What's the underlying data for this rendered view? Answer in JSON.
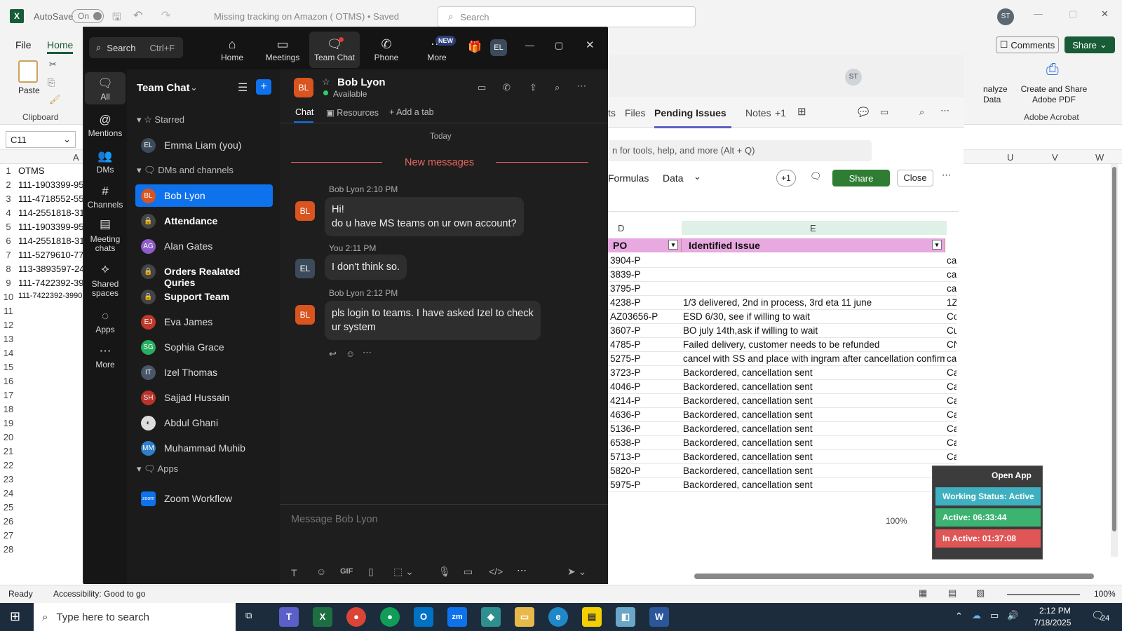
{
  "excel": {
    "autosave_label": "AutoSave",
    "autosave_state": "On",
    "doc_title": "Missing tracking on Amazon ( OTMS) • Saved",
    "search_placeholder": "Search",
    "user_initials": "ST",
    "menu": [
      "File",
      "Home"
    ],
    "comments_label": "Comments",
    "share_label": "Share",
    "paste_label": "Paste",
    "clipboard_label": "Clipboard",
    "analyze_label": "nalyze\nData",
    "create_share_pdf": "Create and Share Adobe PDF",
    "adobe_acrobat": "Adobe Acrobat",
    "name_box": "C11",
    "col_a": "A",
    "col_u": "U",
    "col_v": "V",
    "col_w": "W",
    "rows": [
      "1",
      "2",
      "3",
      "4",
      "5",
      "6",
      "7",
      "8",
      "9",
      "10",
      "11",
      "12",
      "13",
      "14",
      "15",
      "16",
      "17",
      "18",
      "19",
      "20",
      "21",
      "22",
      "23",
      "24",
      "25",
      "26",
      "27",
      "28"
    ],
    "col_a_values": [
      "OTMS",
      "111-1903399-95",
      "111-4718552-55",
      "114-2551818-31",
      "111-1903399-95",
      "114-2551818-31",
      "111-5279610-77",
      "113-3893597-24",
      "111-7422392-39",
      "111-7422392-3990"
    ],
    "status_ready": "Ready",
    "status_accessibility": "Accessibility: Good to go",
    "zoom_level": "100%"
  },
  "teams_panel": {
    "tabs": [
      "ts",
      "Files",
      "Pending Issues",
      "Notes",
      "+1"
    ],
    "search_hint": "n for tools, help, and more (Alt + Q)",
    "formulas": "Formulas",
    "data": "Data",
    "plus_one": "+1",
    "share": "Share",
    "close": "Close",
    "col_d": "D",
    "col_e": "E",
    "header_po": "PO",
    "header_issue": "Identified Issue",
    "zoom_level": "100%",
    "rows": [
      {
        "po": "3904-P",
        "issue": "",
        "f": "ca"
      },
      {
        "po": "3839-P",
        "issue": "",
        "f": "ca"
      },
      {
        "po": "3795-P",
        "issue": "",
        "f": "ca"
      },
      {
        "po": "4238-P",
        "issue": "1/3 delivered, 2nd in process, 3rd eta 11 june",
        "f": "1Z"
      },
      {
        "po": "AZ03656-P",
        "issue": "ESD 6/30, see if willing to wait",
        "f": "Co"
      },
      {
        "po": "3607-P",
        "issue": "BO july 14th,ask if willing to wait",
        "f": "Cu"
      },
      {
        "po": "4785-P",
        "issue": "Failed delivery, customer needs to be refunded",
        "f": "CN"
      },
      {
        "po": "5275-P",
        "issue": "cancel with SS and place with ingram after cancellation confirma",
        "f": "ca"
      },
      {
        "po": "3723-P",
        "issue": "Backordered, cancellation sent",
        "f": "Ca"
      },
      {
        "po": "4046-P",
        "issue": "Backordered, cancellation sent",
        "f": "Ca"
      },
      {
        "po": "4214-P",
        "issue": "Backordered, cancellation sent",
        "f": "Ca"
      },
      {
        "po": "4636-P",
        "issue": "Backordered, cancellation sent",
        "f": "Ca"
      },
      {
        "po": "5136-P",
        "issue": "Backordered, cancellation sent",
        "f": "Ca"
      },
      {
        "po": "6538-P",
        "issue": "Backordered, cancellation sent",
        "f": "Ca"
      },
      {
        "po": "5713-P",
        "issue": "Backordered, cancellation sent",
        "f": "Ca"
      },
      {
        "po": "5820-P",
        "issue": "Backordered, cancellation sent",
        "f": "Ca"
      },
      {
        "po": "5975-P",
        "issue": "Backordered, cancellation sent",
        "f": "Ca"
      }
    ]
  },
  "zoom": {
    "search_label": "Search",
    "search_shortcut": "Ctrl+F",
    "nav": [
      "Home",
      "Meetings",
      "Team Chat",
      "Phone",
      "More"
    ],
    "new_badge": "NEW",
    "user_initials": "EL",
    "rail": [
      "All",
      "Mentions",
      "DMs",
      "Channels",
      "Meeting chats",
      "Shared spaces",
      "Apps",
      "More"
    ],
    "sidebar_title": "Team Chat",
    "starred": "Starred",
    "dms_channels": "DMs and channels",
    "apps_head": "Apps",
    "sidebar_items": [
      {
        "initials": "EL",
        "name": "Emma Liam (you)"
      },
      {
        "initials": "BL",
        "name": "Bob Lyon"
      },
      {
        "initials": "",
        "name": "Attendance"
      },
      {
        "initials": "AG",
        "name": "Alan Gates"
      },
      {
        "initials": "",
        "name": "Orders Realated Quries"
      },
      {
        "initials": "",
        "name": "Support Team"
      },
      {
        "initials": "EJ",
        "name": "Eva James"
      },
      {
        "initials": "SG",
        "name": "Sophia Grace"
      },
      {
        "initials": "IT",
        "name": "Izel Thomas"
      },
      {
        "initials": "SH",
        "name": "Sajjad Hussain"
      },
      {
        "initials": "",
        "name": "Abdul Ghani"
      },
      {
        "initials": "MM",
        "name": "Muhammad Muhib"
      },
      {
        "initials": "zoom",
        "name": "Zoom Workflow"
      }
    ],
    "chat": {
      "contact": "Bob Lyon",
      "contact_initials": "BL",
      "status": "Available",
      "tabs": [
        "Chat",
        "Resources",
        "Add a tab"
      ],
      "today": "Today",
      "new_messages": "New messages",
      "messages": [
        {
          "initials": "BL",
          "meta": "Bob Lyon 2:10 PM",
          "lines": [
            "Hi!",
            "do u have MS teams on ur own account?"
          ]
        },
        {
          "initials": "EL",
          "meta": "You 2:11 PM",
          "lines": [
            "I don't think so."
          ]
        },
        {
          "initials": "BL",
          "meta": "Bob Lyon 2:12 PM",
          "lines": [
            "pls login to teams. I have asked Izel to check",
            "ur system"
          ]
        }
      ],
      "composer_placeholder": "Message Bob Lyon",
      "gif": "GIF"
    }
  },
  "status_widget": {
    "open_app": "Open App",
    "working": "Working Status: Active",
    "active": "Active: 06:33:44",
    "inactive": "In Active: 01:37:08"
  },
  "taskbar": {
    "search_placeholder": "Type here to search",
    "time": "2:12 PM",
    "date": "7/18/2025",
    "notif_count": "24"
  },
  "colors": {
    "excel_green": "#185c37",
    "zoom_blue": "#0e72ed",
    "header_pink": "#e8a8e0",
    "new_messages_red": "#e8665c",
    "status_teal": "#3fb0c0",
    "status_green": "#3cb371",
    "status_red": "#e05555"
  }
}
